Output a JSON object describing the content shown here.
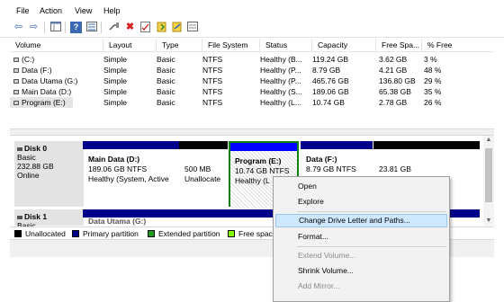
{
  "menu": [
    "File",
    "Action",
    "View",
    "Help"
  ],
  "toolbar": {
    "icons": [
      "back-arrow-icon",
      "forward-arrow-icon",
      "console-tree-icon",
      "help-icon",
      "list-view-icon",
      "connect-icon",
      "delete-icon",
      "properties-icon",
      "rescan-icon",
      "refresh-icon",
      "disk-list-icon"
    ],
    "glyphs": {
      "back": "⇦",
      "forward": "⇨",
      "delete": "✖",
      "help": "?"
    }
  },
  "volumes": {
    "columns": [
      "Volume",
      "Layout",
      "Type",
      "File System",
      "Status",
      "Capacity",
      "Free Spa...",
      "% Free"
    ],
    "rows": [
      [
        "(C:)",
        "Simple",
        "Basic",
        "NTFS",
        "Healthy (B...",
        "119.24 GB",
        "3.62 GB",
        "3 %"
      ],
      [
        "Data (F:)",
        "Simple",
        "Basic",
        "NTFS",
        "Healthy (P...",
        "8.79 GB",
        "4.21 GB",
        "48 %"
      ],
      [
        "Data Utama (G:)",
        "Simple",
        "Basic",
        "NTFS",
        "Healthy (P...",
        "465.76 GB",
        "136.80 GB",
        "29 %"
      ],
      [
        "Main Data (D:)",
        "Simple",
        "Basic",
        "NTFS",
        "Healthy (S...",
        "189.06 GB",
        "65.38 GB",
        "35 %"
      ],
      [
        "Program (E:)",
        "Simple",
        "Basic",
        "NTFS",
        "Healthy (L...",
        "10.74 GB",
        "2.78 GB",
        "26 %"
      ]
    ]
  },
  "disk0": {
    "name": "Disk 0",
    "type": "Basic",
    "size": "232.88 GB",
    "status": "Online",
    "partitions": [
      {
        "title": "Main Data  (D:)",
        "size": "189.06 GB NTFS",
        "status": "Healthy (System, Active",
        "bar_color": "#00008b"
      },
      {
        "title": "",
        "size": "500 MB",
        "status": "Unallocate",
        "bar_color": "#000000"
      },
      {
        "title": "Program  (E:)",
        "size": "10.74 GB NTFS",
        "status": "Healthy (L",
        "bar_color": "#0000ff"
      },
      {
        "title": "Data  (F:)",
        "size": "8.79 GB NTFS",
        "status": "",
        "bar_color": "#00008b"
      },
      {
        "title": "",
        "size": "23.81 GB",
        "status": "",
        "bar_color": "#000000"
      }
    ]
  },
  "disk1": {
    "name": "Disk 1",
    "type": "Basic",
    "partition_partial": "Data Utama (G:)"
  },
  "legend": [
    {
      "label": "Unallocated",
      "color": "#000000"
    },
    {
      "label": "Primary partition",
      "color": "#00008b"
    },
    {
      "label": "Extended partition",
      "color": "#1e9e1e"
    },
    {
      "label": "Free spac",
      "color": "#7fff00"
    }
  ],
  "context_menu": [
    {
      "label": "Open",
      "disabled": false
    },
    {
      "label": "Explore",
      "disabled": false
    },
    {
      "label": "Change Drive Letter and Paths...",
      "disabled": false,
      "highlighted": true
    },
    {
      "label": "Format...",
      "disabled": false
    },
    {
      "label": "Extend Volume...",
      "disabled": true
    },
    {
      "label": "Shrink Volume...",
      "disabled": false
    },
    {
      "label": "Add Mirror...",
      "disabled": true
    }
  ],
  "colors": {
    "highlight": "#cde8ff",
    "selection_border": "#108010"
  }
}
